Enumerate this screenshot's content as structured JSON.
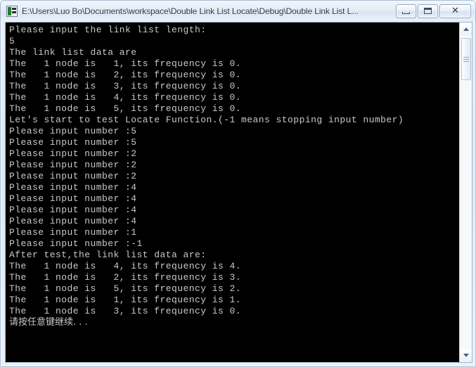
{
  "window": {
    "title": "E:\\Users\\Luo Bo\\Documents\\workspace\\Double Link List Locate\\Debug\\Double Link List L...",
    "icon": "console-app-icon",
    "buttons": {
      "minimize_label": "Minimize",
      "maximize_label": "Maximize",
      "close_label": "Close",
      "close_glyph": "✕"
    }
  },
  "console": {
    "background_color": "#000000",
    "text_color": "#c8c8c8",
    "lines": [
      "Please input the link list length:",
      "5",
      "The link list data are",
      "The   1 node is   1, its frequency is 0.",
      "The   1 node is   2, its frequency is 0.",
      "The   1 node is   3, its frequency is 0.",
      "The   1 node is   4, its frequency is 0.",
      "The   1 node is   5, its frequency is 0.",
      "Let's start to test Locate Function.(-1 means stopping input number)",
      "Please input number :5",
      "Please input number :5",
      "Please input number :2",
      "Please input number :2",
      "Please input number :2",
      "Please input number :4",
      "Please input number :4",
      "Please input number :4",
      "Please input number :4",
      "Please input number :1",
      "Please input number :-1",
      "After test,the link list data are:",
      "The   1 node is   4, its frequency is 4.",
      "The   1 node is   2, its frequency is 3.",
      "The   1 node is   5, its frequency is 2.",
      "The   1 node is   1, its frequency is 1.",
      "The   1 node is   3, its frequency is 0."
    ],
    "prompt_line": "请按任意键继续. . .",
    "scrollbar": {
      "up_arrow": "scroll-up-arrow-icon",
      "down_arrow": "scroll-down-arrow-icon",
      "thumb": "scroll-thumb"
    }
  }
}
